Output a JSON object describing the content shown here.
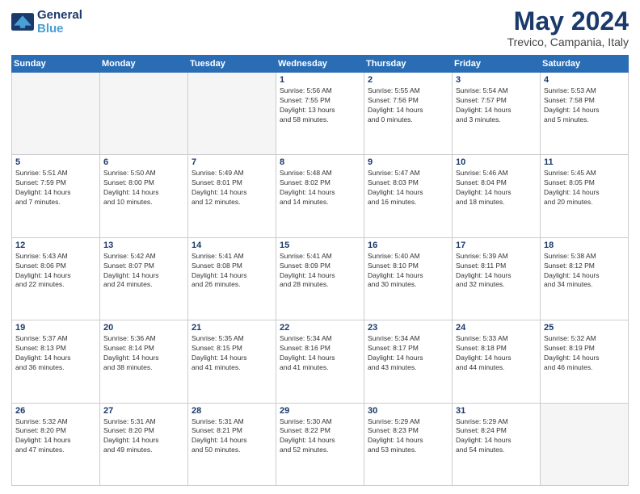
{
  "logo": {
    "line1": "General",
    "line2": "Blue"
  },
  "title": "May 2024",
  "location": "Trevico, Campania, Italy",
  "days_of_week": [
    "Sunday",
    "Monday",
    "Tuesday",
    "Wednesday",
    "Thursday",
    "Friday",
    "Saturday"
  ],
  "weeks": [
    [
      {
        "day": "",
        "info": ""
      },
      {
        "day": "",
        "info": ""
      },
      {
        "day": "",
        "info": ""
      },
      {
        "day": "1",
        "info": "Sunrise: 5:56 AM\nSunset: 7:55 PM\nDaylight: 13 hours\nand 58 minutes."
      },
      {
        "day": "2",
        "info": "Sunrise: 5:55 AM\nSunset: 7:56 PM\nDaylight: 14 hours\nand 0 minutes."
      },
      {
        "day": "3",
        "info": "Sunrise: 5:54 AM\nSunset: 7:57 PM\nDaylight: 14 hours\nand 3 minutes."
      },
      {
        "day": "4",
        "info": "Sunrise: 5:53 AM\nSunset: 7:58 PM\nDaylight: 14 hours\nand 5 minutes."
      }
    ],
    [
      {
        "day": "5",
        "info": "Sunrise: 5:51 AM\nSunset: 7:59 PM\nDaylight: 14 hours\nand 7 minutes."
      },
      {
        "day": "6",
        "info": "Sunrise: 5:50 AM\nSunset: 8:00 PM\nDaylight: 14 hours\nand 10 minutes."
      },
      {
        "day": "7",
        "info": "Sunrise: 5:49 AM\nSunset: 8:01 PM\nDaylight: 14 hours\nand 12 minutes."
      },
      {
        "day": "8",
        "info": "Sunrise: 5:48 AM\nSunset: 8:02 PM\nDaylight: 14 hours\nand 14 minutes."
      },
      {
        "day": "9",
        "info": "Sunrise: 5:47 AM\nSunset: 8:03 PM\nDaylight: 14 hours\nand 16 minutes."
      },
      {
        "day": "10",
        "info": "Sunrise: 5:46 AM\nSunset: 8:04 PM\nDaylight: 14 hours\nand 18 minutes."
      },
      {
        "day": "11",
        "info": "Sunrise: 5:45 AM\nSunset: 8:05 PM\nDaylight: 14 hours\nand 20 minutes."
      }
    ],
    [
      {
        "day": "12",
        "info": "Sunrise: 5:43 AM\nSunset: 8:06 PM\nDaylight: 14 hours\nand 22 minutes."
      },
      {
        "day": "13",
        "info": "Sunrise: 5:42 AM\nSunset: 8:07 PM\nDaylight: 14 hours\nand 24 minutes."
      },
      {
        "day": "14",
        "info": "Sunrise: 5:41 AM\nSunset: 8:08 PM\nDaylight: 14 hours\nand 26 minutes."
      },
      {
        "day": "15",
        "info": "Sunrise: 5:41 AM\nSunset: 8:09 PM\nDaylight: 14 hours\nand 28 minutes."
      },
      {
        "day": "16",
        "info": "Sunrise: 5:40 AM\nSunset: 8:10 PM\nDaylight: 14 hours\nand 30 minutes."
      },
      {
        "day": "17",
        "info": "Sunrise: 5:39 AM\nSunset: 8:11 PM\nDaylight: 14 hours\nand 32 minutes."
      },
      {
        "day": "18",
        "info": "Sunrise: 5:38 AM\nSunset: 8:12 PM\nDaylight: 14 hours\nand 34 minutes."
      }
    ],
    [
      {
        "day": "19",
        "info": "Sunrise: 5:37 AM\nSunset: 8:13 PM\nDaylight: 14 hours\nand 36 minutes."
      },
      {
        "day": "20",
        "info": "Sunrise: 5:36 AM\nSunset: 8:14 PM\nDaylight: 14 hours\nand 38 minutes."
      },
      {
        "day": "21",
        "info": "Sunrise: 5:35 AM\nSunset: 8:15 PM\nDaylight: 14 hours\nand 41 minutes."
      },
      {
        "day": "22",
        "info": "Sunrise: 5:34 AM\nSunset: 8:16 PM\nDaylight: 14 hours\nand 41 minutes."
      },
      {
        "day": "23",
        "info": "Sunrise: 5:34 AM\nSunset: 8:17 PM\nDaylight: 14 hours\nand 43 minutes."
      },
      {
        "day": "24",
        "info": "Sunrise: 5:33 AM\nSunset: 8:18 PM\nDaylight: 14 hours\nand 44 minutes."
      },
      {
        "day": "25",
        "info": "Sunrise: 5:32 AM\nSunset: 8:19 PM\nDaylight: 14 hours\nand 46 minutes."
      }
    ],
    [
      {
        "day": "26",
        "info": "Sunrise: 5:32 AM\nSunset: 8:20 PM\nDaylight: 14 hours\nand 47 minutes."
      },
      {
        "day": "27",
        "info": "Sunrise: 5:31 AM\nSunset: 8:20 PM\nDaylight: 14 hours\nand 49 minutes."
      },
      {
        "day": "28",
        "info": "Sunrise: 5:31 AM\nSunset: 8:21 PM\nDaylight: 14 hours\nand 50 minutes."
      },
      {
        "day": "29",
        "info": "Sunrise: 5:30 AM\nSunset: 8:22 PM\nDaylight: 14 hours\nand 52 minutes."
      },
      {
        "day": "30",
        "info": "Sunrise: 5:29 AM\nSunset: 8:23 PM\nDaylight: 14 hours\nand 53 minutes."
      },
      {
        "day": "31",
        "info": "Sunrise: 5:29 AM\nSunset: 8:24 PM\nDaylight: 14 hours\nand 54 minutes."
      },
      {
        "day": "",
        "info": ""
      }
    ]
  ]
}
